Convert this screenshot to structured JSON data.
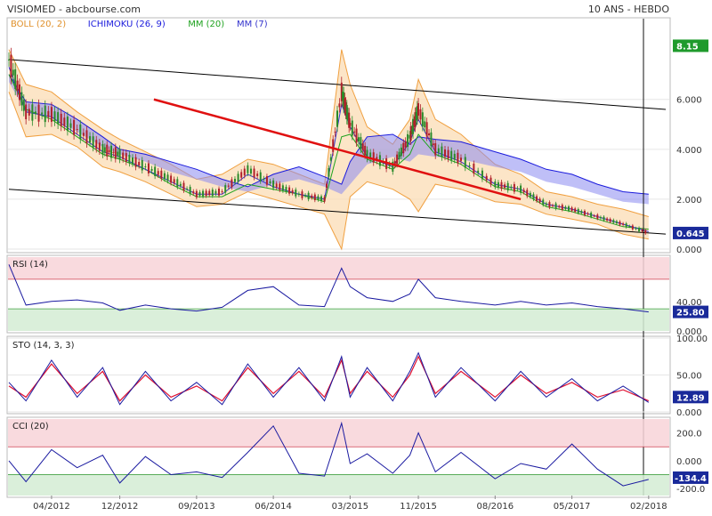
{
  "header": {
    "title": "VISIOMED - abcbourse.com",
    "period": "10 ANS - HEBDO"
  },
  "colors": {
    "price_up": "#2a8a2a",
    "price_down": "#b0202a",
    "boll": "#f0a040",
    "boll_fill": "#fbdcb4",
    "cloud": "#8a8af0",
    "ichimoku": "#1a1adc",
    "mm20": "#1fa21f",
    "mm7": "#3333cc",
    "trend_red": "#e01010",
    "channel": "#000000",
    "osc_line": "#1a1aa0",
    "sto_signal": "#e01030",
    "zone_high": "#f8d4d8",
    "zone_low": "#d4ecd4",
    "label_box": "#1f9a2c",
    "value_box": "#1a2a9a"
  },
  "chart_data": [
    {
      "type": "line",
      "name": "price",
      "legend": [
        {
          "label": "BOLL (20, 2)",
          "color": "#e0902a"
        },
        {
          "label": "ICHIMOKU (26, 9)",
          "color": "#1a1adc"
        },
        {
          "label": "MM (20)",
          "color": "#1fa21f"
        },
        {
          "label": "MM (7)",
          "color": "#3333cc"
        }
      ],
      "x_ticks": [
        "04/2012",
        "12/2012",
        "09/2013",
        "06/2014",
        "03/2015",
        "11/2015",
        "08/2016",
        "05/2017",
        "02/2018"
      ],
      "y_ticks": [
        "0.000",
        "2.000",
        "4.000",
        "6.000"
      ],
      "ylim": [
        0,
        9.2
      ],
      "value_boxes": [
        {
          "label": "8.15",
          "value": 8.15
        },
        {
          "label": "0.645",
          "value": 0.645
        }
      ],
      "x": [
        "2011-11",
        "2012-01",
        "2012-04",
        "2012-07",
        "2012-10",
        "2012-12",
        "2013-03",
        "2013-06",
        "2013-09",
        "2013-12",
        "2014-03",
        "2014-06",
        "2014-09",
        "2014-12",
        "2015-02",
        "2015-03",
        "2015-05",
        "2015-08",
        "2015-10",
        "2015-11",
        "2016-01",
        "2016-04",
        "2016-08",
        "2016-11",
        "2017-02",
        "2017-05",
        "2017-08",
        "2017-11",
        "2018-02"
      ],
      "close": [
        7.6,
        5.5,
        5.4,
        4.8,
        4.0,
        3.8,
        3.3,
        2.8,
        2.2,
        2.3,
        3.2,
        2.6,
        2.2,
        2.0,
        6.3,
        5.0,
        3.8,
        3.3,
        4.5,
        5.6,
        4.0,
        3.6,
        2.6,
        2.4,
        1.8,
        1.6,
        1.3,
        1.0,
        0.65
      ],
      "boll_upper": [
        8.0,
        6.6,
        6.3,
        5.5,
        4.8,
        4.4,
        3.9,
        3.4,
        2.8,
        3.0,
        3.6,
        3.4,
        3.0,
        2.6,
        8.0,
        6.6,
        4.9,
        4.2,
        5.2,
        6.8,
        5.2,
        4.6,
        3.4,
        3.0,
        2.3,
        2.1,
        1.8,
        1.6,
        1.3
      ],
      "boll_lower": [
        6.3,
        4.5,
        4.6,
        4.1,
        3.3,
        3.1,
        2.7,
        2.2,
        1.7,
        1.8,
        2.3,
        2.0,
        1.7,
        1.4,
        0.0,
        2.1,
        2.7,
        2.4,
        2.0,
        1.5,
        2.6,
        2.4,
        1.9,
        1.8,
        1.4,
        1.2,
        1.0,
        0.6,
        0.4
      ],
      "cloud_top": [
        7.0,
        5.9,
        5.8,
        5.2,
        4.5,
        4.0,
        3.8,
        3.5,
        3.2,
        2.8,
        2.5,
        3.0,
        3.3,
        2.9,
        2.6,
        3.5,
        4.5,
        4.6,
        4.2,
        4.5,
        4.4,
        4.3,
        3.9,
        3.6,
        3.2,
        3.0,
        2.6,
        2.3,
        2.2
      ],
      "cloud_bottom": [
        6.7,
        5.5,
        5.3,
        4.7,
        4.1,
        3.8,
        3.5,
        3.1,
        2.8,
        2.5,
        2.3,
        2.6,
        2.8,
        2.5,
        2.2,
        2.6,
        3.4,
        3.7,
        3.5,
        3.8,
        3.7,
        3.6,
        3.3,
        3.1,
        2.7,
        2.5,
        2.2,
        1.9,
        1.8
      ],
      "mm20": [
        7.0,
        5.6,
        5.2,
        4.5,
        3.8,
        3.6,
        3.2,
        2.6,
        2.1,
        2.1,
        2.6,
        2.4,
        2.2,
        1.9,
        4.5,
        4.6,
        3.6,
        3.2,
        3.8,
        4.6,
        3.8,
        3.4,
        2.5,
        2.3,
        1.7,
        1.5,
        1.2,
        0.9,
        0.8
      ],
      "mm7": [
        7.3,
        5.5,
        5.3,
        4.6,
        3.9,
        3.7,
        3.2,
        2.7,
        2.2,
        2.2,
        3.0,
        2.5,
        2.2,
        2.0,
        5.8,
        4.9,
        3.7,
        3.3,
        4.3,
        5.2,
        3.9,
        3.5,
        2.6,
        2.4,
        1.8,
        1.6,
        1.3,
        1.0,
        0.7
      ],
      "red_trend": {
        "x": [
          "2013-04",
          "2016-11"
        ],
        "y": [
          6.0,
          2.0
        ]
      },
      "channel_upper": {
        "x": [
          "2011-11",
          "2018-04"
        ],
        "y": [
          7.6,
          5.6
        ]
      },
      "channel_lower": {
        "x": [
          "2011-11",
          "2018-04"
        ],
        "y": [
          2.4,
          0.6
        ]
      }
    },
    {
      "type": "line",
      "name": "RSI",
      "title": "RSI (14)",
      "y_ticks": [
        "40.00",
        "0.000"
      ],
      "zones": {
        "high": 70,
        "low": 30
      },
      "ylim": [
        0,
        100
      ],
      "value_box": "25.80",
      "x": [
        "2011-11",
        "2012-01",
        "2012-04",
        "2012-07",
        "2012-10",
        "2012-12",
        "2013-03",
        "2013-06",
        "2013-09",
        "2013-12",
        "2014-03",
        "2014-06",
        "2014-09",
        "2014-12",
        "2015-02",
        "2015-03",
        "2015-05",
        "2015-08",
        "2015-10",
        "2015-11",
        "2016-01",
        "2016-04",
        "2016-08",
        "2016-11",
        "2017-02",
        "2017-05",
        "2017-08",
        "2017-11",
        "2018-02"
      ],
      "y": [
        90,
        35,
        40,
        42,
        38,
        28,
        35,
        30,
        27,
        32,
        55,
        60,
        35,
        33,
        85,
        60,
        45,
        40,
        50,
        70,
        45,
        40,
        35,
        40,
        35,
        38,
        33,
        30,
        25.8
      ]
    },
    {
      "type": "line",
      "name": "STO",
      "title": "STO (14, 3, 3)",
      "y_ticks": [
        "100.00",
        "50.00",
        "0.000"
      ],
      "ylim": [
        0,
        100
      ],
      "value_box": "12.89",
      "x": [
        "2011-11",
        "2012-01",
        "2012-04",
        "2012-07",
        "2012-10",
        "2012-12",
        "2013-03",
        "2013-06",
        "2013-09",
        "2013-12",
        "2014-03",
        "2014-06",
        "2014-09",
        "2014-12",
        "2015-02",
        "2015-03",
        "2015-05",
        "2015-08",
        "2015-10",
        "2015-11",
        "2016-01",
        "2016-04",
        "2016-08",
        "2016-11",
        "2017-02",
        "2017-05",
        "2017-08",
        "2017-11",
        "2018-02"
      ],
      "k": [
        40,
        15,
        70,
        20,
        60,
        10,
        55,
        15,
        40,
        10,
        65,
        20,
        60,
        15,
        75,
        20,
        60,
        15,
        55,
        80,
        20,
        60,
        15,
        55,
        20,
        45,
        15,
        35,
        12.89
      ],
      "d": [
        35,
        20,
        65,
        25,
        55,
        15,
        50,
        20,
        35,
        15,
        60,
        25,
        55,
        20,
        70,
        25,
        55,
        20,
        50,
        75,
        25,
        55,
        20,
        50,
        25,
        40,
        20,
        30,
        15
      ]
    },
    {
      "type": "line",
      "name": "CCI",
      "title": "CCI (20)",
      "y_ticks": [
        "200.0",
        "0.000",
        "-200.0"
      ],
      "zones": {
        "high": 100,
        "low": -100
      },
      "ylim": [
        -250,
        300
      ],
      "value_box": "-134.4",
      "x": [
        "2011-11",
        "2012-01",
        "2012-04",
        "2012-07",
        "2012-10",
        "2012-12",
        "2013-03",
        "2013-06",
        "2013-09",
        "2013-12",
        "2014-03",
        "2014-06",
        "2014-09",
        "2014-12",
        "2015-02",
        "2015-03",
        "2015-05",
        "2015-08",
        "2015-10",
        "2015-11",
        "2016-01",
        "2016-04",
        "2016-08",
        "2016-11",
        "2017-02",
        "2017-05",
        "2017-08",
        "2017-11",
        "2018-02"
      ],
      "y": [
        0,
        -150,
        80,
        -50,
        40,
        -160,
        30,
        -100,
        -80,
        -120,
        60,
        250,
        -90,
        -110,
        270,
        -20,
        50,
        -90,
        40,
        200,
        -80,
        60,
        -130,
        -20,
        -60,
        120,
        -60,
        -180,
        -134.4
      ]
    }
  ]
}
